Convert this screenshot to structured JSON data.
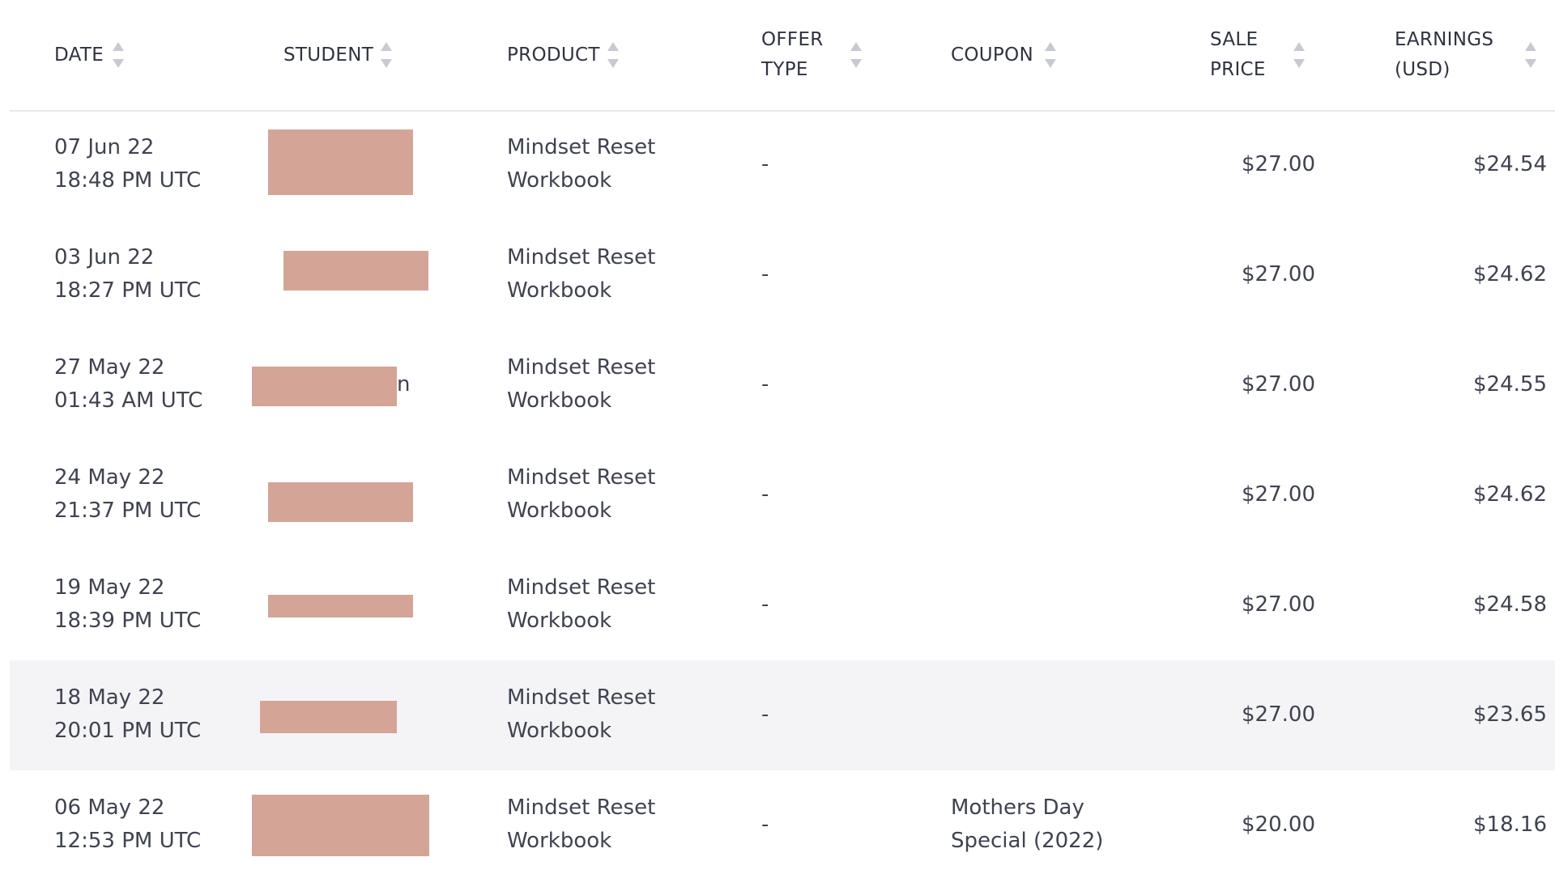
{
  "columns": {
    "date": "DATE",
    "student": "STUDENT",
    "product": "PRODUCT",
    "offer_type": [
      "OFFER",
      "TYPE"
    ],
    "coupon": "COUPON",
    "sale_price": [
      "SALE",
      "PRICE"
    ],
    "earnings": [
      "EARNINGS",
      "(USD)"
    ]
  },
  "rows": [
    {
      "date": "07 Jun 22",
      "time": "18:48 PM UTC",
      "product": [
        "Mindset Reset",
        "Workbook"
      ],
      "offer_type": "-",
      "coupon": [
        "",
        ""
      ],
      "sale_price": "$27.00",
      "earnings": "$24.54"
    },
    {
      "date": "03 Jun 22",
      "time": "18:27 PM UTC",
      "product": [
        "Mindset Reset",
        "Workbook"
      ],
      "offer_type": "-",
      "coupon": [
        "",
        ""
      ],
      "sale_price": "$27.00",
      "earnings": "$24.62"
    },
    {
      "date": "27 May 22",
      "time": "01:43 AM UTC",
      "product": [
        "Mindset Reset",
        "Workbook"
      ],
      "offer_type": "-",
      "coupon": [
        "",
        ""
      ],
      "sale_price": "$27.00",
      "earnings": "$24.55",
      "student_fragment": "n"
    },
    {
      "date": "24 May 22",
      "time": "21:37 PM UTC",
      "product": [
        "Mindset Reset",
        "Workbook"
      ],
      "offer_type": "-",
      "coupon": [
        "",
        ""
      ],
      "sale_price": "$27.00",
      "earnings": "$24.62"
    },
    {
      "date": "19 May 22",
      "time": "18:39 PM UTC",
      "product": [
        "Mindset Reset",
        "Workbook"
      ],
      "offer_type": "-",
      "coupon": [
        "",
        ""
      ],
      "sale_price": "$27.00",
      "earnings": "$24.58"
    },
    {
      "date": "18 May 22",
      "time": "20:01 PM UTC",
      "product": [
        "Mindset Reset",
        "Workbook"
      ],
      "offer_type": "-",
      "coupon": [
        "",
        ""
      ],
      "sale_price": "$27.00",
      "earnings": "$23.65"
    },
    {
      "date": "06 May 22",
      "time": "12:53 PM UTC",
      "product": [
        "Mindset Reset",
        "Workbook"
      ],
      "offer_type": "-",
      "coupon": [
        "Mothers Day",
        "Special (2022)"
      ],
      "sale_price": "$20.00",
      "earnings": "$18.16"
    }
  ],
  "colors": {
    "redaction": "#d4a497",
    "row_hover": "#f4f4f6",
    "divider": "#e6e8ec",
    "text": "#3f4350"
  }
}
